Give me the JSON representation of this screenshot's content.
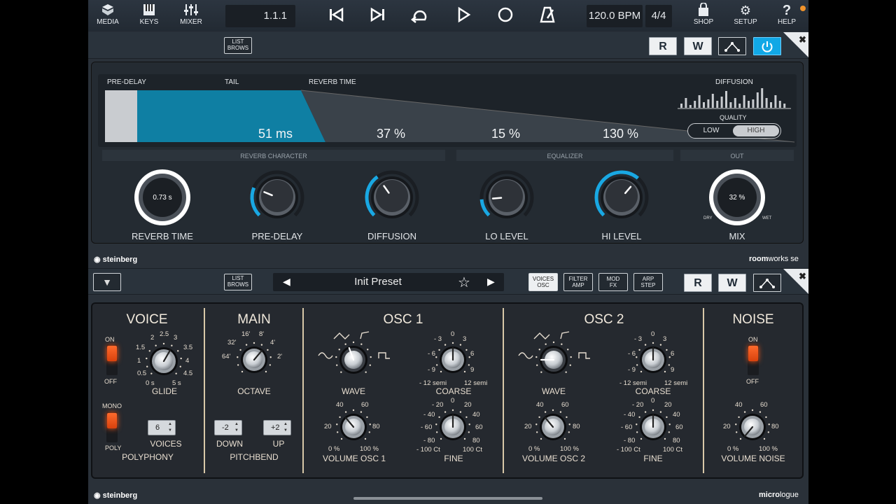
{
  "toolbar": {
    "media_label": "MEDIA",
    "keys_label": "KEYS",
    "mixer_label": "MIXER",
    "position": "1.1.1",
    "tempo": "120.0 BPM",
    "signature": "4/4",
    "shop_label": "SHOP",
    "setup_label": "SETUP",
    "help_label": "HELP"
  },
  "roomworks": {
    "list_browse_line1": "LIST",
    "list_browse_line2": "BROWS",
    "r_label": "R",
    "w_label": "W",
    "display": {
      "pre_delay_label": "PRE-DELAY",
      "tail_label": "TAIL",
      "reverb_time_label": "REVERB TIME",
      "diffusion_label": "DIFFUSION",
      "quality_label": "QUALITY",
      "quality_low": "LOW",
      "quality_high": "HIGH",
      "quality_selected": "HIGH",
      "predelay_value": "51 ms",
      "diffusion_value": "37 %",
      "lo_value": "15 %",
      "hi_value": "130 %"
    },
    "sections": {
      "character": "REVERB CHARACTER",
      "equalizer": "EQUALIZER",
      "out": "OUT"
    },
    "knobs": {
      "reverb_time_label": "REVERB TIME",
      "reverb_time_value": "0.73 s",
      "predelay_label": "PRE-DELAY",
      "diffusion_label": "DIFFUSION",
      "lo_level_label": "LO LEVEL",
      "hi_level_label": "HI LEVEL",
      "mix_label": "MIX",
      "mix_value": "32 %",
      "mix_dry": "DRY",
      "mix_wet": "WET"
    },
    "levels": {
      "predelay": 0.25,
      "diffusion": 0.37,
      "lo": 0.15,
      "hi": 0.65,
      "mix": 0.32
    },
    "brand": "steinberg",
    "product_left": "room",
    "product_right": "works se"
  },
  "micrologue": {
    "list_browse_line1": "LIST",
    "list_browse_line2": "BROWS",
    "preset_name": "Init Preset",
    "tabs": [
      {
        "line1": "VOICES",
        "line2": "OSC"
      },
      {
        "line1": "FILTER",
        "line2": "AMP"
      },
      {
        "line1": "MOD",
        "line2": "FX"
      },
      {
        "line1": "ARP",
        "line2": "STEP"
      }
    ],
    "r_label": "R",
    "w_label": "W",
    "voice": {
      "title": "VOICE",
      "on": "ON",
      "off": "OFF",
      "glide_label": "GLIDE",
      "glide_ticks": [
        "0 s",
        "0.5",
        "1",
        "1.5",
        "2",
        "2.5",
        "3",
        "3.5",
        "4",
        "4.5",
        "5 s"
      ],
      "mono": "MONO",
      "poly": "POLY",
      "voices_value": "6",
      "voices_label": "VOICES",
      "polyphony_label": "POLYPHONY"
    },
    "main": {
      "title": "MAIN",
      "octave_label": "OCTAVE",
      "octave_ticks": [
        "64'",
        "32'",
        "16'",
        "8'",
        "4'",
        "2'"
      ],
      "down_value": "-2",
      "up_value": "+2",
      "down_label": "DOWN",
      "up_label": "UP",
      "pitchbend_label": "PITCHBEND"
    },
    "osc1": {
      "title": "OSC 1",
      "wave_label": "WAVE",
      "coarse_label": "COARSE",
      "volume_label": "VOLUME OSC 1",
      "fine_label": "FINE"
    },
    "osc2": {
      "title": "OSC 2",
      "wave_label": "WAVE",
      "coarse_label": "COARSE",
      "volume_label": "VOLUME OSC 2",
      "fine_label": "FINE"
    },
    "coarse_ticks": [
      "- 3",
      "0",
      "3",
      "- 6",
      "6",
      "- 9",
      "9",
      "- 12 semi",
      "12 semi"
    ],
    "volume_ticks": [
      "40",
      "60",
      "20",
      "80",
      "0 %",
      "100 %"
    ],
    "fine_ticks": [
      "- 20",
      "0",
      "20",
      "- 40",
      "40",
      "- 60",
      "60",
      "- 80",
      "80",
      "- 100 Ct",
      "100 Ct"
    ],
    "noise": {
      "title": "NOISE",
      "on": "ON",
      "off": "OFF",
      "volume_label": "VOLUME NOISE"
    },
    "brand": "steinberg",
    "product_left": "micro",
    "product_right": "logue"
  }
}
